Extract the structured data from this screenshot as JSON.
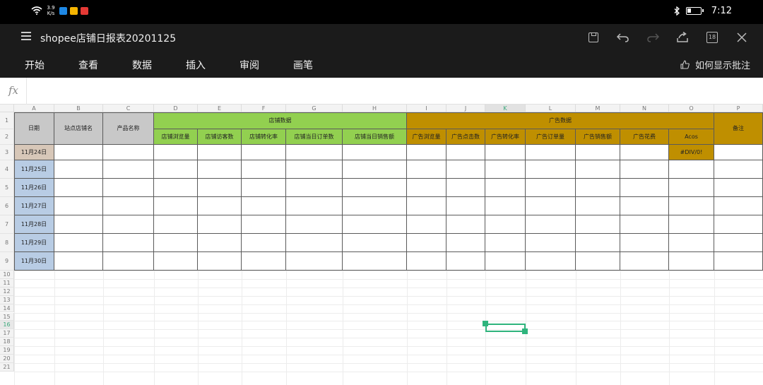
{
  "status_bar": {
    "net_speed_value": "3.9",
    "net_speed_unit": "K/s",
    "time": "7:12",
    "bluetooth_icon": "bluetooth-icon",
    "battery_icon": "battery-icon",
    "app_colors": [
      "#1e88e5",
      "#f4b400",
      "#e53935"
    ]
  },
  "title_bar": {
    "doc_title": "shopee店铺日报表20201125",
    "sheet_count": "18"
  },
  "menu": {
    "tabs": [
      "开始",
      "查看",
      "数据",
      "插入",
      "审阅",
      "画笔"
    ],
    "hint_label": "如何显示批注"
  },
  "formula_bar": {
    "fx_label": "fx",
    "value": ""
  },
  "sheet": {
    "active_column": "K",
    "active_row": "16",
    "columns": [
      "A",
      "B",
      "C",
      "D",
      "E",
      "F",
      "G",
      "H",
      "I",
      "J",
      "K",
      "L",
      "M",
      "N",
      "O",
      "P"
    ],
    "rows": [
      "1",
      "2",
      "3",
      "4",
      "5",
      "6",
      "7",
      "8",
      "9",
      "10",
      "11",
      "12",
      "13",
      "14",
      "15",
      "16",
      "17",
      "18",
      "19",
      "20",
      "21"
    ],
    "headers": {
      "date": "日期",
      "site_store": "站点店铺名",
      "product_name": "产品名称",
      "store_data": "店铺数据",
      "ad_data": "广告数据",
      "remark": "备注"
    },
    "store_subheaders": [
      "店铺浏览量",
      "店铺访客数",
      "店铺转化率",
      "店铺当日订单数",
      "店铺当日销售额"
    ],
    "ad_subheaders": [
      "广告浏览量",
      "广告点击数",
      "广告转化率",
      "广告订单量",
      "广告销售额",
      "广告花费",
      "Acos"
    ],
    "dates": [
      "11月24日",
      "11月25日",
      "11月26日",
      "11月27日",
      "11月28日",
      "11月29日",
      "11月30日"
    ],
    "acos_row3": "#DIV/0!",
    "colors": {
      "store_header": "#92d050",
      "ad_header": "#bf8f00",
      "label_gray": "#c8c8c8",
      "date_blue": "#b8cce4",
      "selection": "#2fb47d"
    }
  }
}
